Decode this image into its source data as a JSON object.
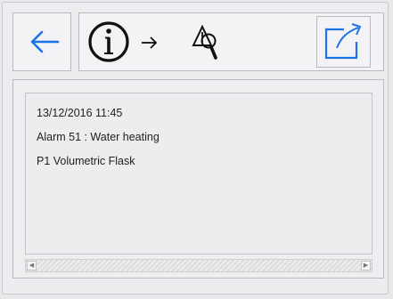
{
  "toolbar": {
    "back_icon": "arrow-left-icon",
    "info_icon": "info-circle-icon",
    "flow_arrow_icon": "arrow-right-icon",
    "alarm_search_icon": "warning-magnifier-icon",
    "export_icon": "export-icon",
    "accent_color": "#1a73e8"
  },
  "alarm": {
    "timestamp": "13/12/2016  11:45",
    "description": "Alarm 51 : Water heating",
    "product": "P1  Volumetric Flask"
  },
  "scrollbar": {
    "left_arrow": "◀",
    "right_arrow": "▶"
  }
}
